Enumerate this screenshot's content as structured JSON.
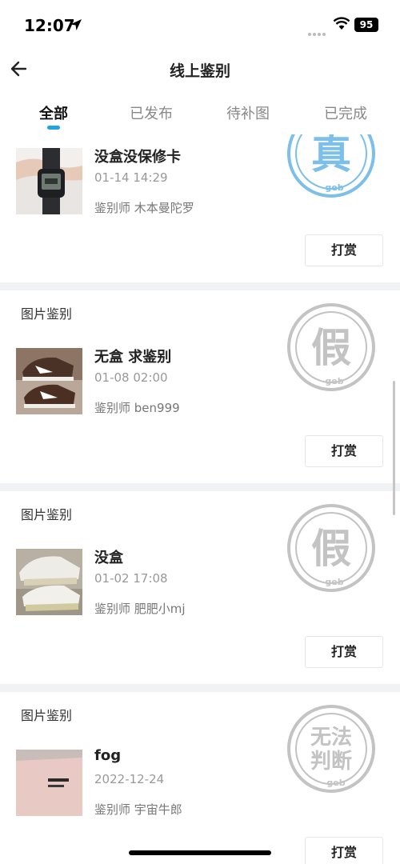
{
  "status_bar": {
    "time": "12:07",
    "battery": "95"
  },
  "nav": {
    "title": "线上鉴别"
  },
  "tabs": [
    {
      "label": "全部",
      "active": true
    },
    {
      "label": "已发布",
      "active": false
    },
    {
      "label": "待补图",
      "active": false
    },
    {
      "label": "已完成",
      "active": false
    }
  ],
  "items": [
    {
      "label": "",
      "title": "没盒没保修卡",
      "date": "01-14 14:29",
      "appraiser": "鉴别师  木本曼陀罗",
      "thumb": "watch-photo",
      "stamp": {
        "text": "真",
        "brand": "geb",
        "color": "#7cbfe9"
      },
      "tip": "打赏"
    },
    {
      "label": "图片鉴别",
      "title": "无盒 求鉴别",
      "date": "01-08 02:00",
      "appraiser": "鉴别师  ben999",
      "thumb": "sneaker-photo",
      "stamp": {
        "text": "假",
        "brand": "geb",
        "color": "#c3c3c3"
      },
      "tip": "打赏"
    },
    {
      "label": "图片鉴别",
      "title": "没盒",
      "date": "01-02 17:08",
      "appraiser": "鉴别师  肥肥小mj",
      "thumb": "white-sneaker-photo",
      "stamp": {
        "text": "假",
        "brand": "geb",
        "color": "#c3c3c3"
      },
      "tip": "打赏"
    },
    {
      "label": "图片鉴别",
      "title": "fog",
      "date": "2022-12-24",
      "appraiser": "鉴别师  宇宙牛郎",
      "thumb": "tshirt-photo",
      "stamp": {
        "text_line1": "无法",
        "text_line2": "判断",
        "brand": "geb",
        "color": "#c3c3c3"
      },
      "tip": "打赏"
    }
  ]
}
